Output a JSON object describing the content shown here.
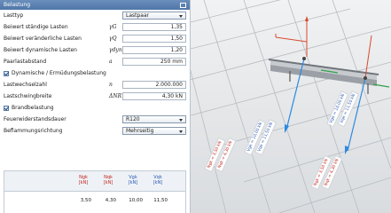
{
  "panel": {
    "title": "Belastung",
    "rows": [
      {
        "label": "Lasttyp",
        "select": "Lastpaar"
      },
      {
        "label": "Beiwert ständige Lasten",
        "symbol": "γG",
        "value": "1,35"
      },
      {
        "label": "Beiwert veränderliche Lasten",
        "symbol": "γQ",
        "value": "1,50"
      },
      {
        "label": "Beiwert dynamische Lasten",
        "symbol": "γdyn",
        "value": "1,20"
      },
      {
        "label": "Paarlastabstand",
        "symbol": "a",
        "value": "250 mm"
      }
    ],
    "check_dynamic": "Dynamische / Ermüdungsbelastung",
    "fatigue_rows": [
      {
        "label": "Lastwechselzahl",
        "symbol": "n",
        "value": "2.000.000"
      },
      {
        "label": "Lastschwingbreite",
        "symbol": "ΔNR",
        "value": "4,30 kN"
      }
    ],
    "check_fire": "Brandbelastung",
    "fire_rows": [
      {
        "label": "Feuerwiderstandsdauer",
        "select": "R120"
      },
      {
        "label": "Beflammungsrichtung",
        "select": "Mehrseitig"
      }
    ],
    "table": {
      "headers": [
        {
          "l1": "Ngk",
          "l2": "[kN]"
        },
        {
          "l1": "Nqk",
          "l2": "[kN]"
        },
        {
          "l1": "Vgk",
          "l2": "[kN]"
        },
        {
          "l1": "Vqk",
          "l2": "[kN]"
        }
      ],
      "row": [
        "3,50",
        "4,30",
        "10,00",
        "11,50"
      ]
    }
  },
  "view": {
    "labels_left": [
      "Ngk = 3,50 kN",
      "Nqk = 4,30 kN"
    ],
    "labels_mid": [
      "Vgk = 10,00 kN",
      "Vqk = 11,50 kN"
    ],
    "labels_right": [
      "Ngk = 3,50 kN",
      "Nqk = 4,30 kN"
    ],
    "labels_far": [
      "Vgk = 10,00 kN",
      "Vqk = 11,50 kN"
    ]
  },
  "colors": {
    "title_bar": "#587fb0",
    "accent_red": "#c0261e",
    "accent_blue": "#2a57b0",
    "arrow_blue": "#2d8ae0",
    "arrow_green": "#2fa24a"
  }
}
